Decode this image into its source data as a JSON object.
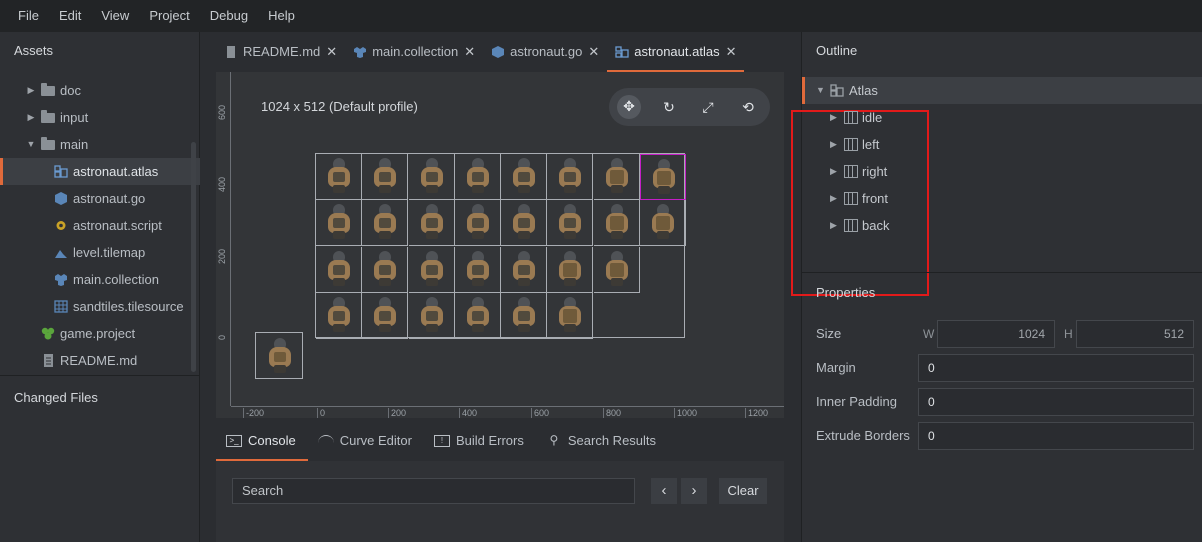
{
  "menu": [
    "File",
    "Edit",
    "View",
    "Project",
    "Debug",
    "Help"
  ],
  "assets": {
    "title": "Assets",
    "items": [
      {
        "label": "doc",
        "type": "folder",
        "expanded": false
      },
      {
        "label": "input",
        "type": "folder",
        "expanded": false
      },
      {
        "label": "main",
        "type": "folder",
        "expanded": true
      },
      {
        "label": "astronaut.atlas",
        "type": "atlas",
        "selected": true
      },
      {
        "label": "astronaut.go",
        "type": "gameobject"
      },
      {
        "label": "astronaut.script",
        "type": "script"
      },
      {
        "label": "level.tilemap",
        "type": "tilemap"
      },
      {
        "label": "main.collection",
        "type": "collection"
      },
      {
        "label": "sandtiles.tilesource",
        "type": "tilesource"
      },
      {
        "label": "game.project",
        "type": "project"
      },
      {
        "label": "README.md",
        "type": "file"
      }
    ]
  },
  "changed_files": {
    "title": "Changed Files"
  },
  "tabs": [
    {
      "label": "README.md",
      "icon": "file-icon",
      "active": false
    },
    {
      "label": "main.collection",
      "icon": "collection-icon",
      "active": false
    },
    {
      "label": "astronaut.go",
      "icon": "gameobject-icon",
      "active": false
    },
    {
      "label": "astronaut.atlas",
      "icon": "atlas-icon",
      "active": true
    }
  ],
  "close_glyph": "✕",
  "viewport": {
    "title": "1024 x 512 (Default profile)",
    "y_ticks": [
      "600",
      "400",
      "200",
      "0"
    ],
    "x_ticks": [
      "-200",
      "0",
      "200",
      "400",
      "600",
      "800",
      "1000",
      "1200"
    ],
    "tools": [
      "move-tool-icon",
      "rotate-tool-icon",
      "scale-tool-icon",
      "camera-reset-icon"
    ]
  },
  "bottom_tabs": [
    {
      "label": "Console",
      "icon": "terminal-icon",
      "active": true
    },
    {
      "label": "Curve Editor",
      "icon": "curve-icon",
      "active": false
    },
    {
      "label": "Build Errors",
      "icon": "error-icon",
      "active": false
    },
    {
      "label": "Search Results",
      "icon": "search-icon",
      "active": false
    }
  ],
  "console": {
    "search_placeholder": "Search",
    "prev": "‹",
    "next": "›",
    "clear_label": "Clear"
  },
  "outline": {
    "title": "Outline",
    "root": "Atlas",
    "children": [
      "idle",
      "left",
      "right",
      "front",
      "back"
    ]
  },
  "properties": {
    "title": "Properties",
    "size_label": "Size",
    "w_label": "W",
    "h_label": "H",
    "width": "1024",
    "height": "512",
    "margin_label": "Margin",
    "margin": "0",
    "inner_padding_label": "Inner Padding",
    "inner_padding": "0",
    "extrude_borders_label": "Extrude Borders",
    "extrude_borders": "0"
  },
  "colors": {
    "accent": "#e06a3b",
    "highlight_box": "#e21a1a",
    "selected_sprite": "#c31ec6"
  }
}
